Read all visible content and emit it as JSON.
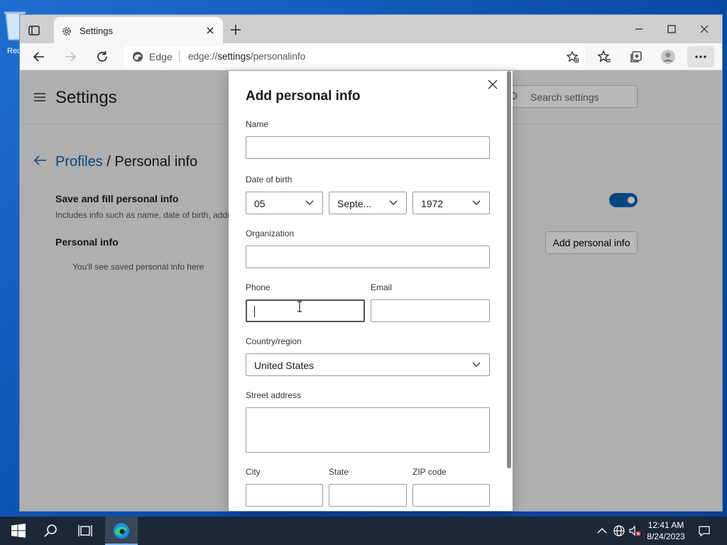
{
  "desktop": {
    "recycle_bin_label": "Rec"
  },
  "browser": {
    "tab_title": "Settings",
    "address_label": "Edge",
    "url_prefix": "edge://",
    "url_host": "settings",
    "url_path": "/personalinfo"
  },
  "settings": {
    "title": "Settings",
    "search_placeholder": "Search settings",
    "breadcrumb_parent": "Profiles",
    "breadcrumb_separator": "/",
    "breadcrumb_current": "Personal info",
    "save_fill_title": "Save and fill personal info",
    "save_fill_desc": "Includes info such as name, date of birth, address",
    "save_fill_enabled": true,
    "personal_info_title": "Personal info",
    "empty_text": "You'll see saved personal info here",
    "add_button": "Add personal info"
  },
  "dialog": {
    "title": "Add personal info",
    "name_label": "Name",
    "name_value": "",
    "dob_label": "Date of birth",
    "dob_day": "05",
    "dob_month": "Septe...",
    "dob_year": "1972",
    "organization_label": "Organization",
    "organization_value": "",
    "phone_label": "Phone",
    "phone_value": "",
    "email_label": "Email",
    "email_value": "",
    "country_label": "Country/region",
    "country_value": "United States",
    "street_label": "Street address",
    "street_value": "",
    "city_label": "City",
    "state_label": "State",
    "zip_label": "ZIP code"
  },
  "taskbar": {
    "time": "12:41 AM",
    "date": "8/24/2023"
  },
  "colors": {
    "accent": "#0f62ad",
    "taskbar": "#1c2738",
    "desktop": "#0a4aa8"
  }
}
